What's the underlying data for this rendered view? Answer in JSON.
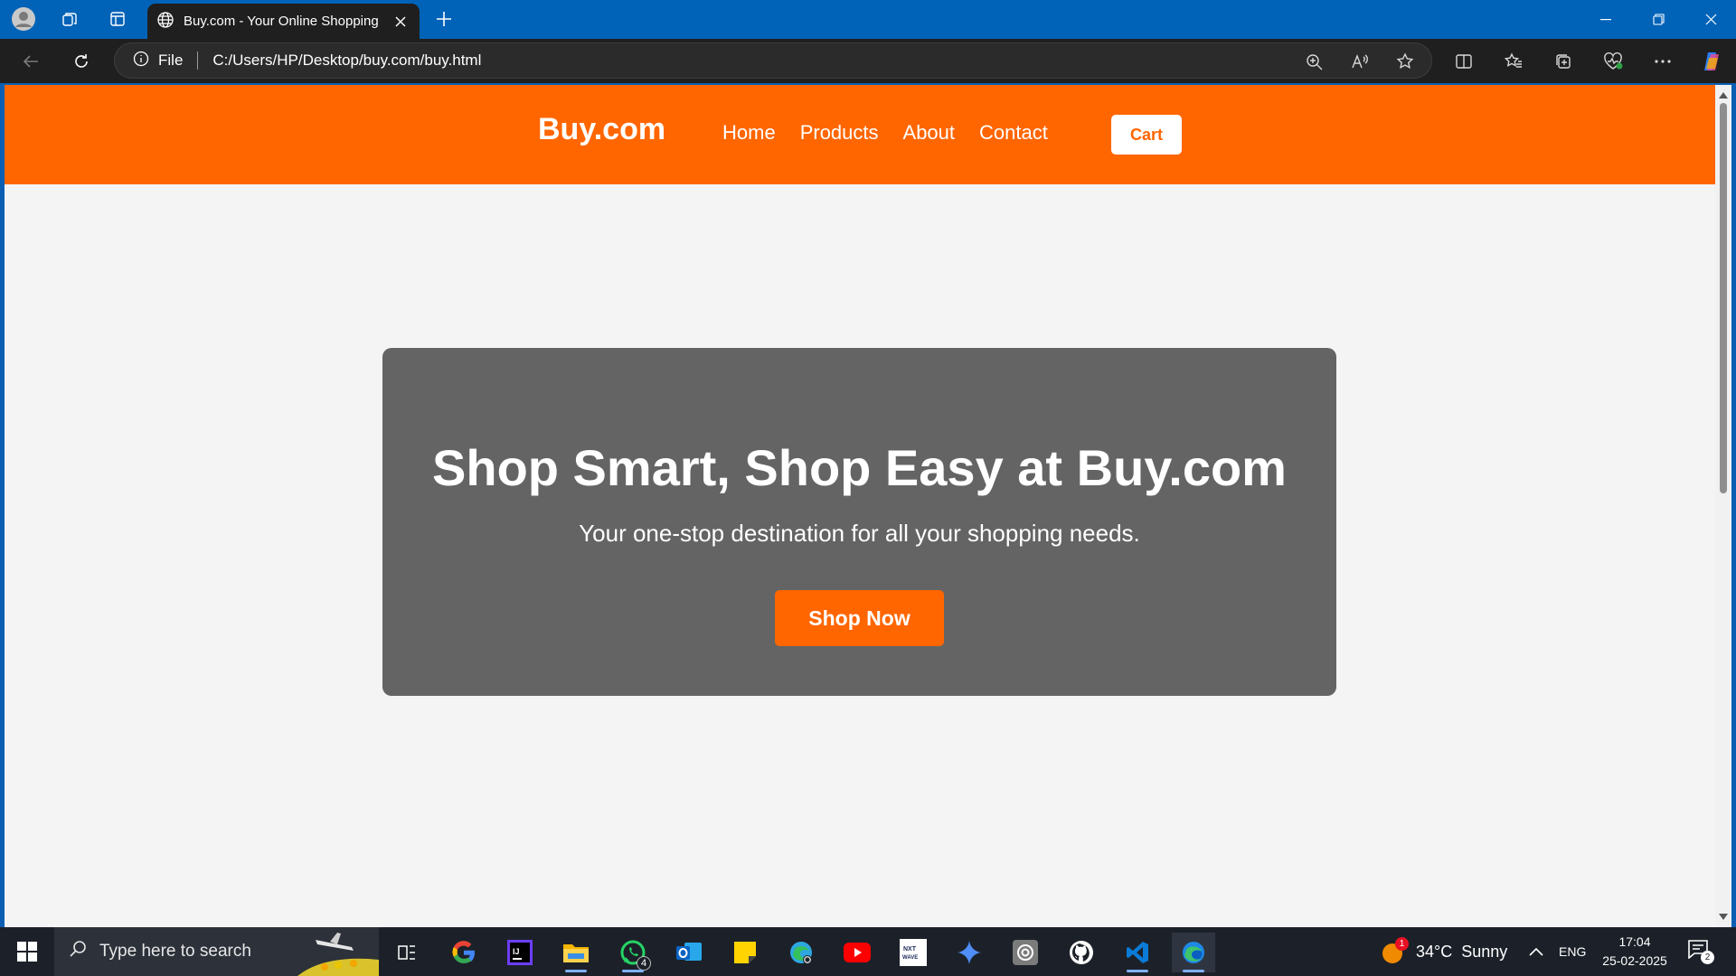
{
  "browser": {
    "tab_title": "Buy.com - Your Online Shopping",
    "address_scheme": "File",
    "address_url": "C:/Users/HP/Desktop/buy.com/buy.html"
  },
  "site": {
    "brand": "Buy.com",
    "nav": [
      "Home",
      "Products",
      "About",
      "Contact"
    ],
    "cart_label": "Cart",
    "hero_title": "Shop Smart, Shop Easy at Buy.com",
    "hero_subtitle": "Your one-stop destination for all your shopping needs.",
    "hero_button": "Shop Now",
    "colors": {
      "primary": "#ff6600",
      "hero_bg": "#646464",
      "page_bg": "#f4f4f4"
    }
  },
  "taskbar": {
    "search_placeholder": "Type here to search",
    "whatsapp_badge": "4",
    "weather_alert": "1",
    "weather": "34°C  Sunny",
    "language": "ENG",
    "time": "17:04",
    "date": "25-02-2025",
    "notifications": "2",
    "pinned_icons": [
      "task-view-icon",
      "google-icon",
      "intellij-icon",
      "file-explorer-icon",
      "whatsapp-icon",
      "outlook-icon",
      "sticky-notes-icon",
      "edge-dev-icon",
      "youtube-icon",
      "nxtwave-icon",
      "gemini-icon",
      "chatgpt-icon",
      "github-icon",
      "vscode-icon",
      "edge-icon"
    ]
  }
}
